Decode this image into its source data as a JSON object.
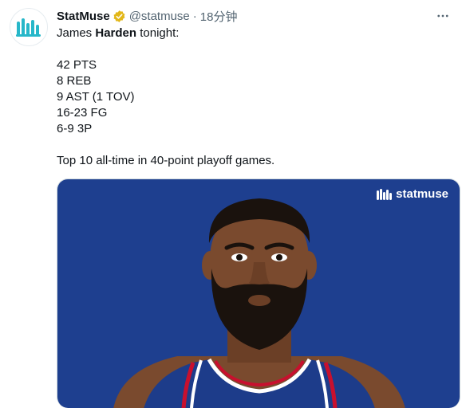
{
  "author": {
    "name": "StatMuse",
    "handle": "@statmuse",
    "separator": "·",
    "time": "18分钟"
  },
  "tweet": {
    "intro_prefix": "James ",
    "intro_bold": "Harden",
    "intro_suffix": " tonight:",
    "stats": [
      "42 PTS",
      "8 REB",
      "9 AST (1 TOV)",
      "16-23 FG",
      "6-9 3P"
    ],
    "closing": "Top 10 all-time in 40-point playoff games."
  },
  "media": {
    "watermark": "statmuse"
  },
  "colors": {
    "media_bg": "#1e3f8f",
    "verified": "#e2b719",
    "jersey_trim_red": "#c8102e",
    "skin": "#7a4a2e",
    "beard": "#1a120d"
  },
  "icons": {
    "avatar": "statmuse-logo-icon",
    "verified": "verified-badge-icon",
    "more": "more-options-icon"
  }
}
